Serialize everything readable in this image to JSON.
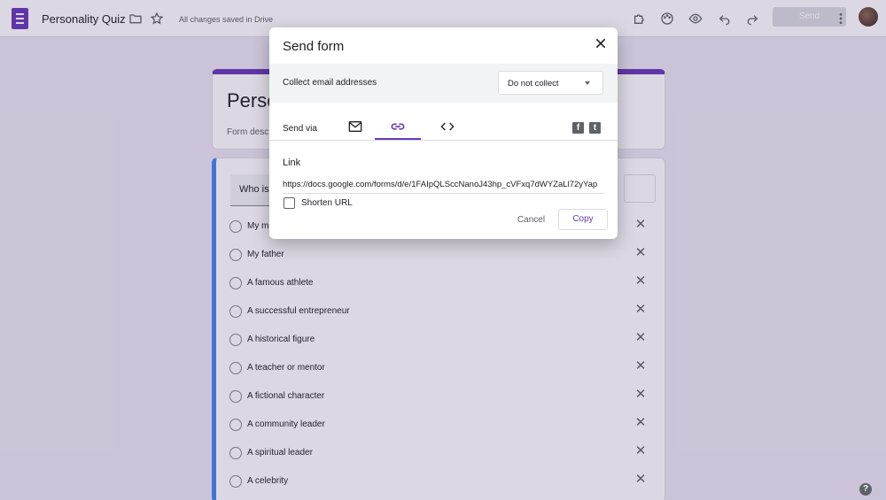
{
  "header": {
    "doc_title": "Personality Quiz",
    "saved_status": "All changes saved in Drive",
    "send_label": "Send"
  },
  "form": {
    "title_partial": "Perso",
    "description_partial": "Form desc",
    "question_partial": "Who is y",
    "options": [
      "My mo",
      "My father",
      "A famous athlete",
      "A successful entrepreneur",
      "A historical figure",
      "A teacher or mentor",
      "A fictional character",
      "A community leader",
      "A spiritual leader",
      "A celebrity"
    ]
  },
  "dialog": {
    "title": "Send form",
    "collect_label": "Collect email addresses",
    "collect_value": "Do not collect",
    "send_via_label": "Send via",
    "tabs": [
      "email",
      "link",
      "embed"
    ],
    "active_tab": "link",
    "link_heading": "Link",
    "link_url": "https://docs.google.com/forms/d/e/1FAIpQLSccNanoJ43hp_cVFxq7dWYZaLl72yYap",
    "shorten_label": "Shorten URL",
    "shorten_checked": false,
    "cancel_label": "Cancel",
    "copy_label": "Copy"
  },
  "colors": {
    "accent": "#673ab7",
    "question_border": "#4285f4"
  },
  "help_glyph": "?"
}
